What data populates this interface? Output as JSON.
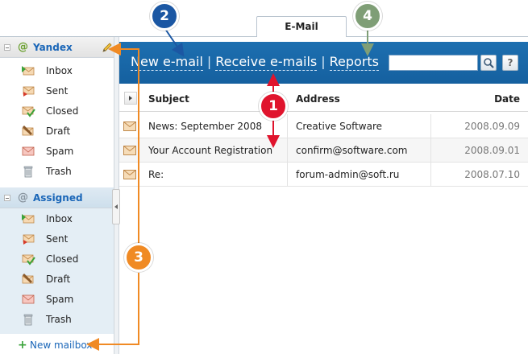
{
  "tabs": [
    {
      "label": "E-Mail",
      "active": true
    }
  ],
  "sidebar": {
    "accounts": [
      {
        "name": "Yandex",
        "folders": [
          {
            "label": "Inbox",
            "icon": "inbox-icon"
          },
          {
            "label": "Sent",
            "icon": "sent-icon"
          },
          {
            "label": "Closed",
            "icon": "closed-icon"
          },
          {
            "label": "Draft",
            "icon": "draft-icon"
          },
          {
            "label": "Spam",
            "icon": "spam-icon"
          },
          {
            "label": "Trash",
            "icon": "trash-icon"
          }
        ]
      },
      {
        "name": "Assigned",
        "folders": [
          {
            "label": "Inbox",
            "icon": "inbox-icon"
          },
          {
            "label": "Sent",
            "icon": "sent-icon"
          },
          {
            "label": "Closed",
            "icon": "closed-icon"
          },
          {
            "label": "Draft",
            "icon": "draft-icon"
          },
          {
            "label": "Spam",
            "icon": "spam-icon"
          },
          {
            "label": "Trash",
            "icon": "trash-icon"
          }
        ]
      }
    ],
    "new_mailbox_label": "New mailbox"
  },
  "toolbar": {
    "links": [
      "New e-mail",
      "Receive e-mails",
      "Reports"
    ],
    "separator": "|",
    "search_value": "",
    "help_label": "?"
  },
  "table": {
    "columns": [
      "Subject",
      "Address",
      "Date"
    ],
    "rows": [
      {
        "subject": "News: September 2008",
        "address": "Creative Software",
        "date": "2008.09.09"
      },
      {
        "subject": "Your Account Registration",
        "address": "confirm@software.com",
        "date": "2008.09.01"
      },
      {
        "subject": "Re:",
        "address": "forum-admin@soft.ru",
        "date": "2008.07.10"
      }
    ]
  },
  "callouts": [
    {
      "number": "1",
      "color": "#e0142d"
    },
    {
      "number": "2",
      "color": "#1b57a3"
    },
    {
      "number": "3",
      "color": "#f08a24"
    },
    {
      "number": "4",
      "color": "#7f9e76"
    }
  ],
  "colors": {
    "toolbar": "#1d6fb0",
    "accent_link": "#1a66b8",
    "assigned_bg": "#e4eef5"
  }
}
